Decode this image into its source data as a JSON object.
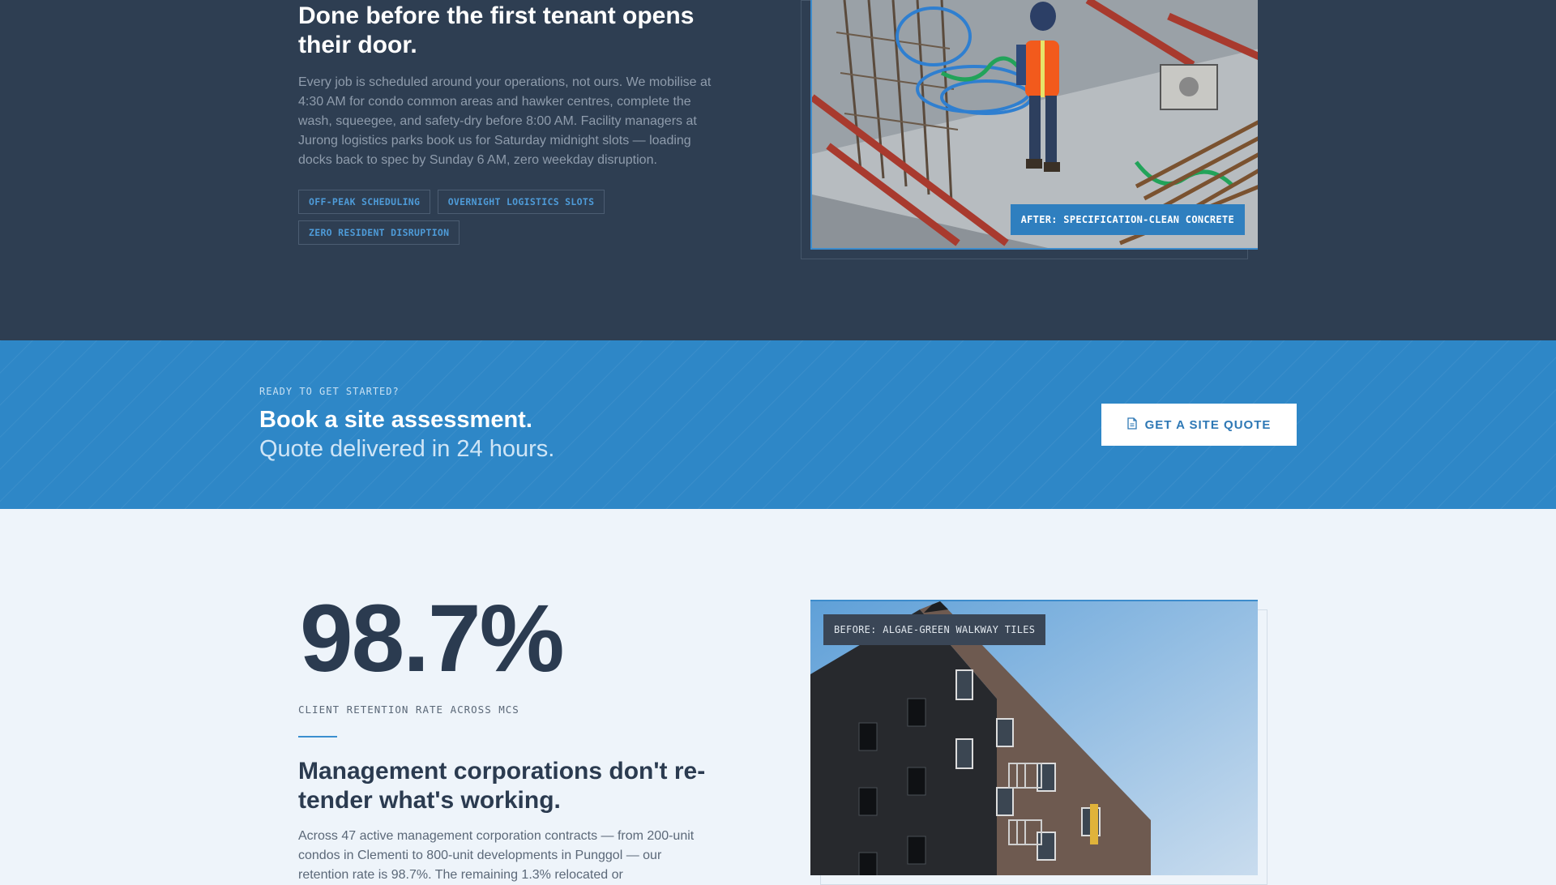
{
  "schedule_section": {
    "heading": "Done before the first tenant opens their door.",
    "body": "Every job is scheduled around your operations, not ours. We mobilise at 4:30 AM for condo common areas and hawker centres, complete the wash, squeegee, and safety-dry before 8:00 AM. Facility managers at Jurong logistics parks book us for Saturday midnight slots — loading docks back to spec by Sunday 6 AM, zero weekday disruption.",
    "tags": [
      "OFF-PEAK SCHEDULING",
      "OVERNIGHT LOGISTICS SLOTS",
      "ZERO RESIDENT DISRUPTION"
    ],
    "image_caption": "AFTER: SPECIFICATION-CLEAN CONCRETE"
  },
  "cta": {
    "eyebrow": "READY TO GET STARTED?",
    "headline": "Book a site assessment.",
    "subline": "Quote delivered in 24 hours.",
    "button_label": "GET A SITE QUOTE",
    "button_icon": "document-icon"
  },
  "retention_section": {
    "stat": "98.7%",
    "stat_label": "CLIENT RETENTION RATE ACROSS MCS",
    "heading": "Management corporations don't re-tender what's working.",
    "body": "Across 47 active management corporation contracts — from 200-unit condos in Clementi to 800-unit developments in Punggol — our retention rate is 98.7%. The remaining 1.3% relocated or",
    "image_caption": "BEFORE: ALGAE-GREEN WALKWAY TILES"
  },
  "colors": {
    "dark_bg": "#2e3e52",
    "accent_blue": "#2e87c7",
    "light_bg": "#eef4fa",
    "heading_dark": "#2b3b50"
  }
}
